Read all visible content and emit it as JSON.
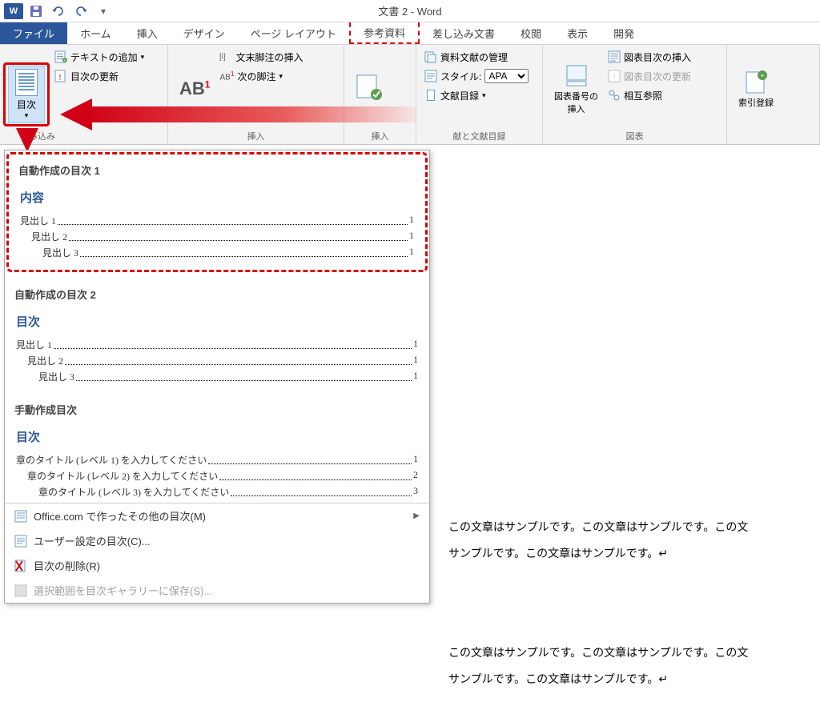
{
  "app": {
    "title": "文書 2 - Word"
  },
  "qat": {
    "logo": "W",
    "save_tip": "保存",
    "undo_tip": "元に戻す",
    "redo_tip": "やり直し"
  },
  "tabs": {
    "file": "ファイル",
    "home": "ホーム",
    "insert": "挿入",
    "design": "デザイン",
    "layout": "ページ レイアウト",
    "references": "参考資料",
    "mailings": "差し込み文書",
    "review": "校閲",
    "view": "表示",
    "developer": "開発"
  },
  "ribbon": {
    "toc_button": "目次",
    "add_text": "テキストの追加",
    "update_toc": "目次の更新",
    "toc_group_extra": "み込み",
    "endnote_insert": "文末脚注の挿入",
    "next_footnote": "次の脚注",
    "ab_big": "AB",
    "citations_manage": "資料文献の管理",
    "style_label": "スタイル:",
    "style_value": "APA",
    "bibliography": "文献目録",
    "citations_group": "献と文献目録",
    "figure_number": "図表番号の\n挿入",
    "insert_figure_toc": "図表目次の挿入",
    "update_figure_toc": "図表目次の更新",
    "xref": "相互参照",
    "figures_group": "図表",
    "mark_index": "索引登録",
    "insert_group": "挿入"
  },
  "dropdown": {
    "auto1_title": "自動作成の目次 1",
    "auto1_heading": "内容",
    "auto2_title": "自動作成の目次 2",
    "auto2_heading": "目次",
    "manual_title": "手動作成目次",
    "manual_heading": "目次",
    "lines_auto": [
      {
        "name": "見出し 1",
        "indent": 0,
        "page": "1"
      },
      {
        "name": "見出し 2",
        "indent": 1,
        "page": "1"
      },
      {
        "name": "見出し 3",
        "indent": 2,
        "page": "1"
      }
    ],
    "lines_manual": [
      {
        "name": "章のタイトル (レベル 1) を入力してください",
        "indent": 0,
        "page": "1"
      },
      {
        "name": "章のタイトル (レベル 2) を入力してください",
        "indent": 1,
        "page": "2"
      },
      {
        "name": "章のタイトル (レベル 3) を入力してください",
        "indent": 2,
        "page": "3"
      }
    ],
    "office_more": "Office.com で作ったその他の目次(M)",
    "custom_toc": "ユーザー設定の目次(C)...",
    "remove_toc": "目次の削除(R)",
    "save_gallery": "選択範囲を目次ギャラリーに保存(S)..."
  },
  "document": {
    "para1": "この文章はサンプルです。この文章はサンプルです。この文",
    "para2": "サンプルです。この文章はサンプルです。",
    "para3": "この文章はサンプルです。この文章はサンプルです。この文",
    "para4": "サンプルです。この文章はサンプルです。"
  }
}
